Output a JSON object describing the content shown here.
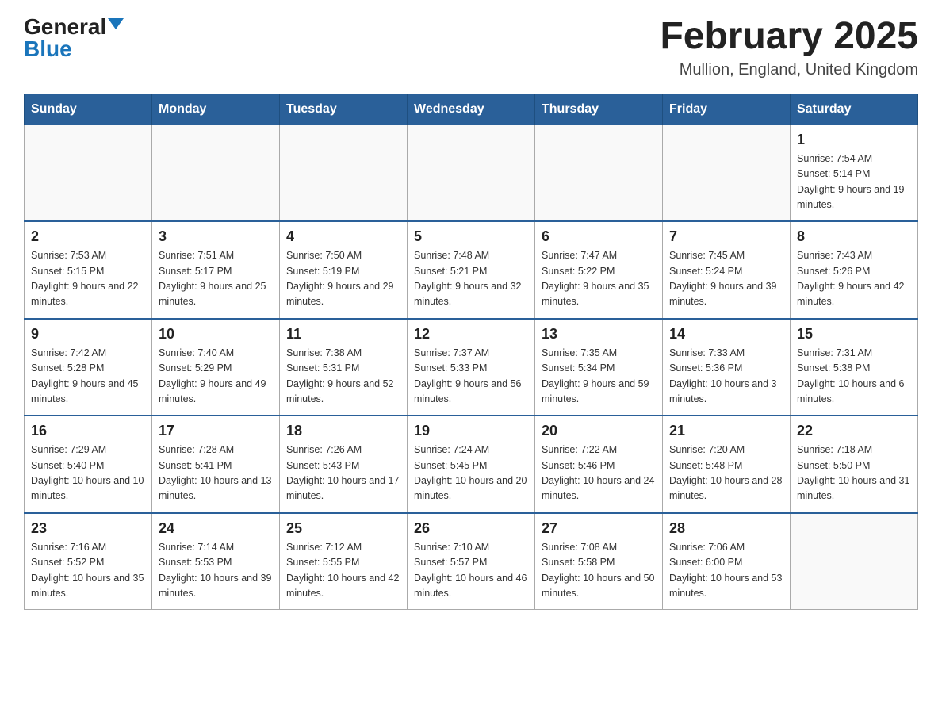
{
  "logo": {
    "general": "General",
    "blue": "Blue"
  },
  "title": "February 2025",
  "subtitle": "Mullion, England, United Kingdom",
  "weekdays": [
    "Sunday",
    "Monday",
    "Tuesday",
    "Wednesday",
    "Thursday",
    "Friday",
    "Saturday"
  ],
  "weeks": [
    [
      {
        "day": "",
        "info": ""
      },
      {
        "day": "",
        "info": ""
      },
      {
        "day": "",
        "info": ""
      },
      {
        "day": "",
        "info": ""
      },
      {
        "day": "",
        "info": ""
      },
      {
        "day": "",
        "info": ""
      },
      {
        "day": "1",
        "info": "Sunrise: 7:54 AM\nSunset: 5:14 PM\nDaylight: 9 hours and 19 minutes."
      }
    ],
    [
      {
        "day": "2",
        "info": "Sunrise: 7:53 AM\nSunset: 5:15 PM\nDaylight: 9 hours and 22 minutes."
      },
      {
        "day": "3",
        "info": "Sunrise: 7:51 AM\nSunset: 5:17 PM\nDaylight: 9 hours and 25 minutes."
      },
      {
        "day": "4",
        "info": "Sunrise: 7:50 AM\nSunset: 5:19 PM\nDaylight: 9 hours and 29 minutes."
      },
      {
        "day": "5",
        "info": "Sunrise: 7:48 AM\nSunset: 5:21 PM\nDaylight: 9 hours and 32 minutes."
      },
      {
        "day": "6",
        "info": "Sunrise: 7:47 AM\nSunset: 5:22 PM\nDaylight: 9 hours and 35 minutes."
      },
      {
        "day": "7",
        "info": "Sunrise: 7:45 AM\nSunset: 5:24 PM\nDaylight: 9 hours and 39 minutes."
      },
      {
        "day": "8",
        "info": "Sunrise: 7:43 AM\nSunset: 5:26 PM\nDaylight: 9 hours and 42 minutes."
      }
    ],
    [
      {
        "day": "9",
        "info": "Sunrise: 7:42 AM\nSunset: 5:28 PM\nDaylight: 9 hours and 45 minutes."
      },
      {
        "day": "10",
        "info": "Sunrise: 7:40 AM\nSunset: 5:29 PM\nDaylight: 9 hours and 49 minutes."
      },
      {
        "day": "11",
        "info": "Sunrise: 7:38 AM\nSunset: 5:31 PM\nDaylight: 9 hours and 52 minutes."
      },
      {
        "day": "12",
        "info": "Sunrise: 7:37 AM\nSunset: 5:33 PM\nDaylight: 9 hours and 56 minutes."
      },
      {
        "day": "13",
        "info": "Sunrise: 7:35 AM\nSunset: 5:34 PM\nDaylight: 9 hours and 59 minutes."
      },
      {
        "day": "14",
        "info": "Sunrise: 7:33 AM\nSunset: 5:36 PM\nDaylight: 10 hours and 3 minutes."
      },
      {
        "day": "15",
        "info": "Sunrise: 7:31 AM\nSunset: 5:38 PM\nDaylight: 10 hours and 6 minutes."
      }
    ],
    [
      {
        "day": "16",
        "info": "Sunrise: 7:29 AM\nSunset: 5:40 PM\nDaylight: 10 hours and 10 minutes."
      },
      {
        "day": "17",
        "info": "Sunrise: 7:28 AM\nSunset: 5:41 PM\nDaylight: 10 hours and 13 minutes."
      },
      {
        "day": "18",
        "info": "Sunrise: 7:26 AM\nSunset: 5:43 PM\nDaylight: 10 hours and 17 minutes."
      },
      {
        "day": "19",
        "info": "Sunrise: 7:24 AM\nSunset: 5:45 PM\nDaylight: 10 hours and 20 minutes."
      },
      {
        "day": "20",
        "info": "Sunrise: 7:22 AM\nSunset: 5:46 PM\nDaylight: 10 hours and 24 minutes."
      },
      {
        "day": "21",
        "info": "Sunrise: 7:20 AM\nSunset: 5:48 PM\nDaylight: 10 hours and 28 minutes."
      },
      {
        "day": "22",
        "info": "Sunrise: 7:18 AM\nSunset: 5:50 PM\nDaylight: 10 hours and 31 minutes."
      }
    ],
    [
      {
        "day": "23",
        "info": "Sunrise: 7:16 AM\nSunset: 5:52 PM\nDaylight: 10 hours and 35 minutes."
      },
      {
        "day": "24",
        "info": "Sunrise: 7:14 AM\nSunset: 5:53 PM\nDaylight: 10 hours and 39 minutes."
      },
      {
        "day": "25",
        "info": "Sunrise: 7:12 AM\nSunset: 5:55 PM\nDaylight: 10 hours and 42 minutes."
      },
      {
        "day": "26",
        "info": "Sunrise: 7:10 AM\nSunset: 5:57 PM\nDaylight: 10 hours and 46 minutes."
      },
      {
        "day": "27",
        "info": "Sunrise: 7:08 AM\nSunset: 5:58 PM\nDaylight: 10 hours and 50 minutes."
      },
      {
        "day": "28",
        "info": "Sunrise: 7:06 AM\nSunset: 6:00 PM\nDaylight: 10 hours and 53 minutes."
      },
      {
        "day": "",
        "info": ""
      }
    ]
  ]
}
